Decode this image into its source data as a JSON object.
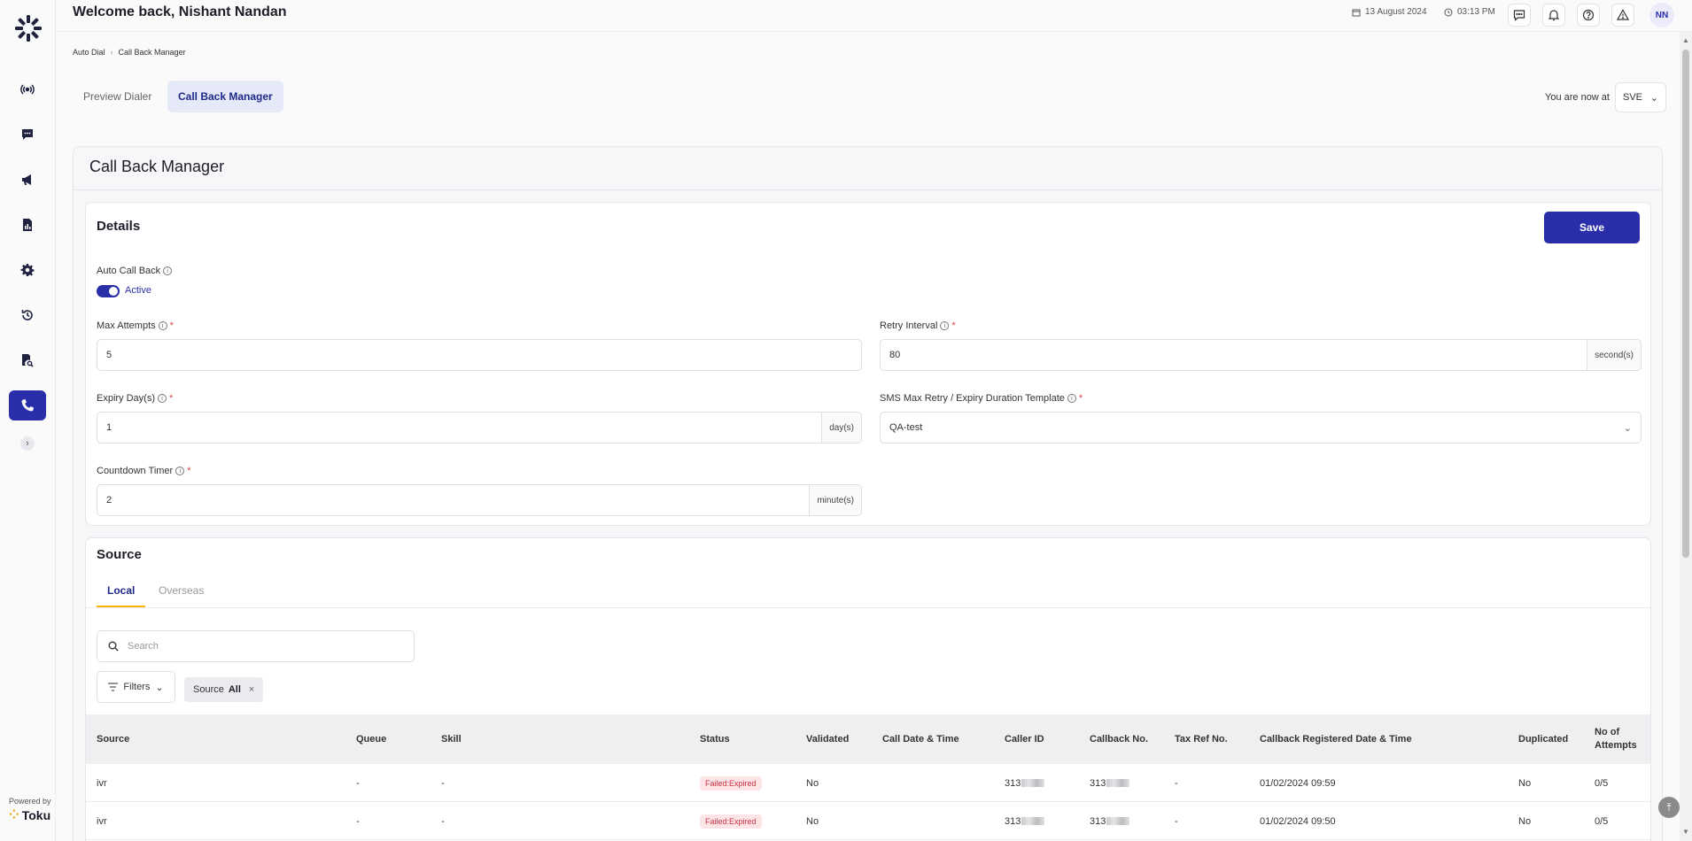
{
  "header": {
    "welcome": "Welcome back, Nishant Nandan",
    "date": "13 August 2024",
    "time": "03:13 PM",
    "avatar_initials": "NN"
  },
  "sidebar": {
    "items": [
      {
        "name": "broadcast-icon"
      },
      {
        "name": "chat-icon"
      },
      {
        "name": "megaphone-icon"
      },
      {
        "name": "report-icon"
      },
      {
        "name": "gear-icon"
      },
      {
        "name": "history-icon"
      },
      {
        "name": "search-document-icon"
      },
      {
        "name": "phone-icon",
        "active": true
      }
    ],
    "powered_by": "Powered by",
    "brand": "Toku"
  },
  "breadcrumb": [
    "Auto Dial",
    "Call Back Manager"
  ],
  "mode_tabs": [
    {
      "label": "Preview Dialer",
      "active": false
    },
    {
      "label": "Call Back Manager",
      "active": true
    }
  ],
  "location": {
    "label": "You are now at",
    "value": "SVE"
  },
  "page_title": "Call Back Manager",
  "details": {
    "title": "Details",
    "save_label": "Save",
    "auto_call_back": {
      "label": "Auto Call Back",
      "state": "Active"
    },
    "max_attempts": {
      "label": "Max Attempts",
      "value": "5"
    },
    "retry_interval": {
      "label": "Retry Interval",
      "value": "80",
      "unit": "second(s)"
    },
    "expiry_days": {
      "label": "Expiry Day(s)",
      "value": "1",
      "unit": "day(s)"
    },
    "sms_template": {
      "label": "SMS Max Retry / Expiry Duration Template",
      "value": "QA-test"
    },
    "countdown": {
      "label": "Countdown Timer",
      "value": "2",
      "unit": "minute(s)"
    }
  },
  "source": {
    "title": "Source",
    "tabs": [
      {
        "label": "Local",
        "active": true
      },
      {
        "label": "Overseas",
        "active": false
      }
    ],
    "search_placeholder": "Search",
    "filters_label": "Filters",
    "chip": {
      "key": "Source",
      "value": "All"
    },
    "columns": [
      "Source",
      "Queue",
      "Skill",
      "Status",
      "Validated",
      "Call Date & Time",
      "Caller ID",
      "Callback No.",
      "Tax Ref No.",
      "Callback Registered Date & Time",
      "Duplicated",
      "No of Attempts"
    ],
    "rows": [
      {
        "source": "ivr",
        "queue": "-",
        "skill": "-",
        "status": "Failed:Expired",
        "validated": "No",
        "call_dt": "",
        "caller_id": "313",
        "callback_no": "313",
        "tax_ref": "-",
        "registered": "01/02/2024 09:59",
        "duplicated": "No",
        "attempts": "0/5"
      },
      {
        "source": "ivr",
        "queue": "-",
        "skill": "-",
        "status": "Failed:Expired",
        "validated": "No",
        "call_dt": "",
        "caller_id": "313",
        "callback_no": "313",
        "tax_ref": "-",
        "registered": "01/02/2024 09:50",
        "duplicated": "No",
        "attempts": "0/5"
      }
    ]
  }
}
